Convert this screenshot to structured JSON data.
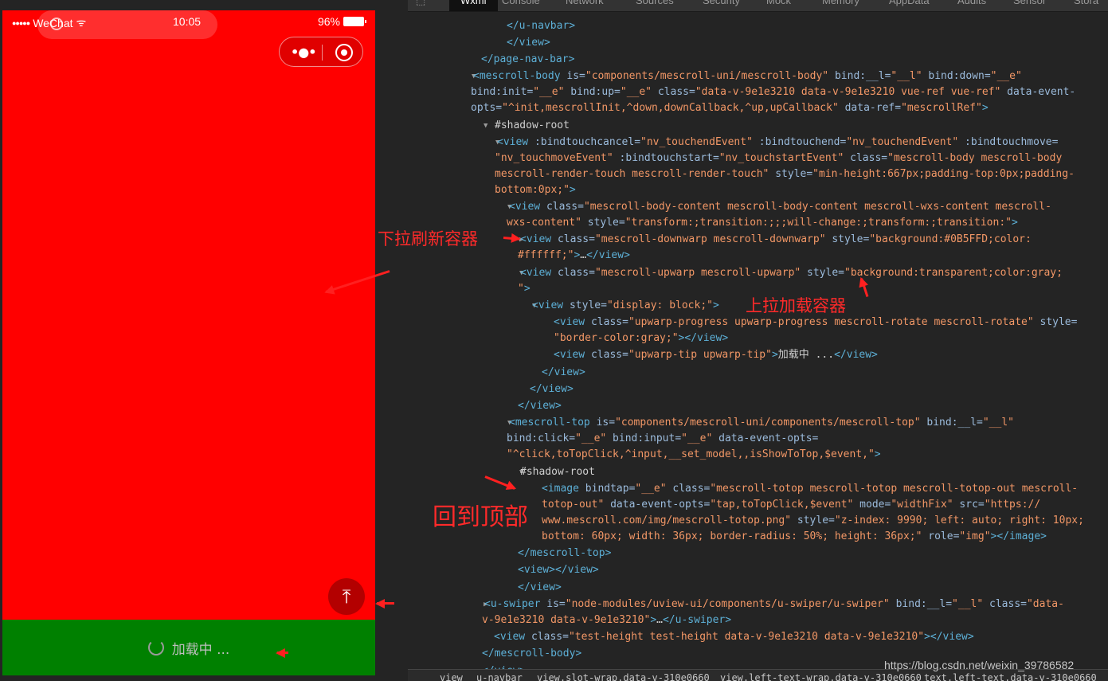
{
  "phone": {
    "status": {
      "signal": "●●●●●",
      "carrier": "WeChat",
      "wifi": "ᯤ",
      "time": "10:05",
      "battery": "96%"
    },
    "capsule": {
      "more": "•●•"
    },
    "totop_glyph": "⤒",
    "loading_text": "加载中 ..."
  },
  "devtools": {
    "tabs": [
      "Wxml",
      "Console",
      "Network",
      "Sources",
      "Security",
      "Mock",
      "Memory",
      "AppData",
      "Audits",
      "Sensor",
      "Stora"
    ],
    "lines": [
      {
        "tri": "",
        "parts": [
          [
            "t",
            "</view>"
          ]
        ]
      },
      {
        "tri": "",
        "parts": [
          [
            "t",
            "</u-navbar>"
          ]
        ]
      },
      {
        "tri": "",
        "parts": [
          [
            "t",
            "</view>"
          ]
        ]
      },
      {
        "tri": "",
        "parts": [
          [
            "t",
            "</page-nav-bar>"
          ]
        ]
      },
      {
        "tri": "▼",
        "parts": [
          [
            "t",
            "<mescroll-body "
          ],
          [
            "a",
            "is="
          ],
          [
            "v",
            "\"components/mescroll-uni/mescroll-body\""
          ],
          [
            "a",
            " bind:__l="
          ],
          [
            "v",
            "\"__l\""
          ],
          [
            "a",
            " bind:down="
          ],
          [
            "v",
            "\"__e\""
          ]
        ]
      },
      {
        "tri": "",
        "parts": [
          [
            "a",
            "bind:init="
          ],
          [
            "v",
            "\"__e\""
          ],
          [
            "a",
            " bind:up="
          ],
          [
            "v",
            "\"__e\""
          ],
          [
            "a",
            " class="
          ],
          [
            "v",
            "\"data-v-9e1e3210 data-v-9e1e3210 vue-ref vue-ref\""
          ],
          [
            "a",
            " data-event-"
          ]
        ]
      },
      {
        "tri": "",
        "parts": [
          [
            "a",
            "opts="
          ],
          [
            "v",
            "\"^init,mescrollInit,^down,downCallback,^up,upCallback\""
          ],
          [
            "a",
            " data-ref="
          ],
          [
            "v",
            "\"mescrollRef\""
          ],
          [
            "t",
            ">"
          ]
        ]
      },
      {
        "tri": "▼",
        "parts": [
          [
            "x",
            "#shadow-root"
          ]
        ]
      },
      {
        "tri": "▼",
        "parts": [
          [
            "t",
            "<view "
          ],
          [
            "a",
            ":bindtouchcancel="
          ],
          [
            "v",
            "\"nv_touchendEvent\""
          ],
          [
            "a",
            " :bindtouchend="
          ],
          [
            "v",
            "\"nv_touchendEvent\""
          ],
          [
            "a",
            " :bindtouchmove="
          ]
        ]
      },
      {
        "tri": "",
        "parts": [
          [
            "v",
            "\"nv_touchmoveEvent\""
          ],
          [
            "a",
            " :bindtouchstart="
          ],
          [
            "v",
            "\"nv_touchstartEvent\""
          ],
          [
            "a",
            " class="
          ],
          [
            "v",
            "\"mescroll-body mescroll-body"
          ]
        ]
      },
      {
        "tri": "",
        "parts": [
          [
            "v",
            "mescroll-render-touch mescroll-render-touch\""
          ],
          [
            "a",
            " style="
          ],
          [
            "v",
            "\"min-height:667px;padding-top:0px;padding-"
          ]
        ]
      },
      {
        "tri": "",
        "parts": [
          [
            "v",
            "bottom:0px;\""
          ],
          [
            "t",
            ">"
          ]
        ]
      },
      {
        "tri": "▼",
        "parts": [
          [
            "t",
            "<view "
          ],
          [
            "a",
            "class="
          ],
          [
            "v",
            "\"mescroll-body-content mescroll-body-content mescroll-wxs-content mescroll-"
          ]
        ]
      },
      {
        "tri": "",
        "parts": [
          [
            "v",
            "wxs-content\""
          ],
          [
            "a",
            " style="
          ],
          [
            "v",
            "\"transform:;transition:;;;will-change:;transform:;transition:\""
          ],
          [
            "t",
            ">"
          ]
        ]
      },
      {
        "tri": "▶",
        "parts": [
          [
            "t",
            "<view "
          ],
          [
            "a",
            "class="
          ],
          [
            "v",
            "\"mescroll-downwarp mescroll-downwarp\""
          ],
          [
            "a",
            " style="
          ],
          [
            "v",
            "\"background:#0B5FFD;color:"
          ]
        ]
      },
      {
        "tri": "",
        "parts": [
          [
            "v",
            "#ffffff;\""
          ],
          [
            "t",
            ">"
          ],
          [
            "x",
            "…"
          ],
          [
            "t",
            "</view>"
          ]
        ]
      },
      {
        "tri": "▼",
        "parts": [
          [
            "t",
            "<view "
          ],
          [
            "a",
            "class="
          ],
          [
            "v",
            "\"mescroll-upwarp mescroll-upwarp\""
          ],
          [
            "a",
            " style="
          ],
          [
            "v",
            "\"background:transparent;color:gray;"
          ]
        ]
      },
      {
        "tri": "",
        "parts": [
          [
            "v",
            "\""
          ],
          [
            "t",
            ">"
          ]
        ]
      },
      {
        "tri": "▼",
        "parts": [
          [
            "t",
            "<view "
          ],
          [
            "a",
            "style="
          ],
          [
            "v",
            "\"display: block;\""
          ],
          [
            "t",
            ">"
          ]
        ]
      },
      {
        "tri": "",
        "parts": [
          [
            "t",
            "<view "
          ],
          [
            "a",
            "class="
          ],
          [
            "v",
            "\"upwarp-progress upwarp-progress mescroll-rotate mescroll-rotate\""
          ],
          [
            "a",
            " style="
          ]
        ]
      },
      {
        "tri": "",
        "parts": [
          [
            "v",
            "\"border-color:gray;\""
          ],
          [
            "t",
            ">"
          ],
          [
            "t",
            "</view>"
          ]
        ]
      },
      {
        "tri": "",
        "parts": [
          [
            "t",
            "<view "
          ],
          [
            "a",
            "class="
          ],
          [
            "v",
            "\"upwarp-tip upwarp-tip\""
          ],
          [
            "t",
            ">"
          ],
          [
            "x",
            "加载中 ..."
          ],
          [
            "t",
            "</view>"
          ]
        ]
      },
      {
        "tri": "",
        "parts": [
          [
            "t",
            "</view>"
          ]
        ]
      },
      {
        "tri": "",
        "parts": [
          [
            "t",
            "</view>"
          ]
        ]
      },
      {
        "tri": "",
        "parts": [
          [
            "t",
            "</view>"
          ]
        ]
      },
      {
        "tri": "▼",
        "parts": [
          [
            "t",
            "<mescroll-top "
          ],
          [
            "a",
            "is="
          ],
          [
            "v",
            "\"components/mescroll-uni/components/mescroll-top\""
          ],
          [
            "a",
            " bind:__l="
          ],
          [
            "v",
            "\"__l\""
          ]
        ]
      },
      {
        "tri": "",
        "parts": [
          [
            "a",
            "bind:click="
          ],
          [
            "v",
            "\"__e\""
          ],
          [
            "a",
            " bind:input="
          ],
          [
            "v",
            "\"__e\""
          ],
          [
            "a",
            " data-event-opts="
          ]
        ]
      },
      {
        "tri": "",
        "parts": [
          [
            "v",
            "\"^click,toTopClick,^input,__set_model,,isShowToTop,$event,\""
          ],
          [
            "t",
            ">"
          ]
        ]
      },
      {
        "tri": "▼",
        "parts": [
          [
            "x",
            "#shadow-root"
          ]
        ]
      },
      {
        "tri": "",
        "parts": [
          [
            "t",
            "<image "
          ],
          [
            "a",
            "bindtap="
          ],
          [
            "v",
            "\"__e\""
          ],
          [
            "a",
            " class="
          ],
          [
            "v",
            "\"mescroll-totop mescroll-totop mescroll-totop-out mescroll-"
          ]
        ]
      },
      {
        "tri": "",
        "parts": [
          [
            "v",
            "totop-out\""
          ],
          [
            "a",
            " data-event-opts="
          ],
          [
            "v",
            "\"tap,toTopClick,$event\""
          ],
          [
            "a",
            " mode="
          ],
          [
            "v",
            "\"widthFix\""
          ],
          [
            "a",
            " src="
          ],
          [
            "v",
            "\"https://"
          ]
        ]
      },
      {
        "tri": "",
        "parts": [
          [
            "v",
            "www.mescroll.com/img/mescroll-totop.png\""
          ],
          [
            "a",
            " style="
          ],
          [
            "v",
            "\"z-index: 9990; left: auto; right: 10px;"
          ]
        ]
      },
      {
        "tri": "",
        "parts": [
          [
            "v",
            "bottom: 60px; width: 36px; border-radius: 50%; height: 36px;\""
          ],
          [
            "a",
            " role="
          ],
          [
            "v",
            "\"img\""
          ],
          [
            "t",
            ">"
          ],
          [
            "t",
            "</image>"
          ]
        ]
      },
      {
        "tri": "",
        "parts": [
          [
            "t",
            "</mescroll-top>"
          ]
        ]
      },
      {
        "tri": "",
        "parts": [
          [
            "t",
            "<view></view>"
          ]
        ]
      },
      {
        "tri": "",
        "parts": [
          [
            "t",
            "</view>"
          ]
        ]
      },
      {
        "tri": "▶",
        "parts": [
          [
            "t",
            "<u-swiper "
          ],
          [
            "a",
            "is="
          ],
          [
            "v",
            "\"node-modules/uview-ui/components/u-swiper/u-swiper\""
          ],
          [
            "a",
            " bind:__l="
          ],
          [
            "v",
            "\"__l\""
          ],
          [
            "a",
            " class="
          ],
          [
            "v",
            "\"data-"
          ]
        ]
      },
      {
        "tri": "",
        "parts": [
          [
            "v",
            "v-9e1e3210 data-v-9e1e3210\""
          ],
          [
            "t",
            ">"
          ],
          [
            "x",
            "…"
          ],
          [
            "t",
            "</u-swiper>"
          ]
        ]
      },
      {
        "tri": "",
        "parts": [
          [
            "t",
            "<view "
          ],
          [
            "a",
            "class="
          ],
          [
            "v",
            "\"test-height test-height data-v-9e1e3210 data-v-9e1e3210\""
          ],
          [
            "t",
            ">"
          ],
          [
            "t",
            "</view>"
          ]
        ]
      },
      {
        "tri": "",
        "parts": [
          [
            "t",
            "</mescroll-body>"
          ]
        ]
      },
      {
        "tri": "",
        "parts": [
          [
            "t",
            "</view>"
          ]
        ]
      }
    ],
    "breadcrumbs": [
      "view",
      "u-navbar",
      "view.slot-wrap.data-v-310e0660",
      "view.left-text-wrap.data-v-310e0660",
      "text.left-text.data-v-310e0660"
    ]
  },
  "annotations": {
    "pulldown": "下拉刷新容器",
    "pullup": "上拉加载容器",
    "totop": "回到顶部"
  },
  "watermark": "https://blog.csdn.net/weixin_39786582",
  "colors": {
    "phone_bg": "#ff0000",
    "loading_bg": "#008000",
    "annotation": "#ff2a2a",
    "tag": "#5db0d7",
    "attr_value": "#f29766"
  }
}
